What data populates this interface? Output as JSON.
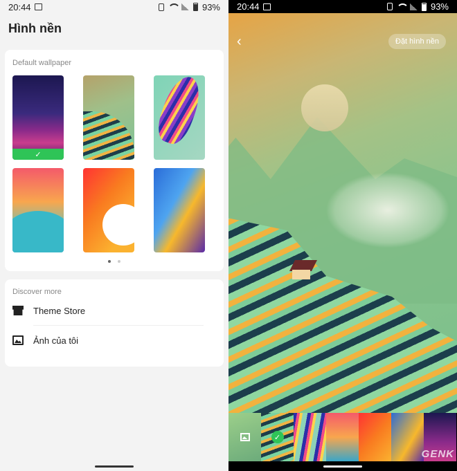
{
  "left": {
    "status": {
      "time": "20:44",
      "battery": "93%"
    },
    "title": "Hình nền",
    "default_section": {
      "title": "Default wallpaper"
    },
    "discover_section": {
      "title": "Discover more",
      "items": [
        {
          "label": "Theme Store",
          "icon": "store-icon"
        },
        {
          "label": "Ảnh của tôi",
          "icon": "image-icon"
        }
      ]
    },
    "page_dots": {
      "count": 2,
      "active": 0
    }
  },
  "right": {
    "status": {
      "time": "20:44",
      "battery": "93%"
    },
    "set_button": "Đặt hình nền",
    "selected_check": "✓",
    "watermark": "GENK"
  },
  "colors": {
    "accent_green": "#2fc457"
  }
}
